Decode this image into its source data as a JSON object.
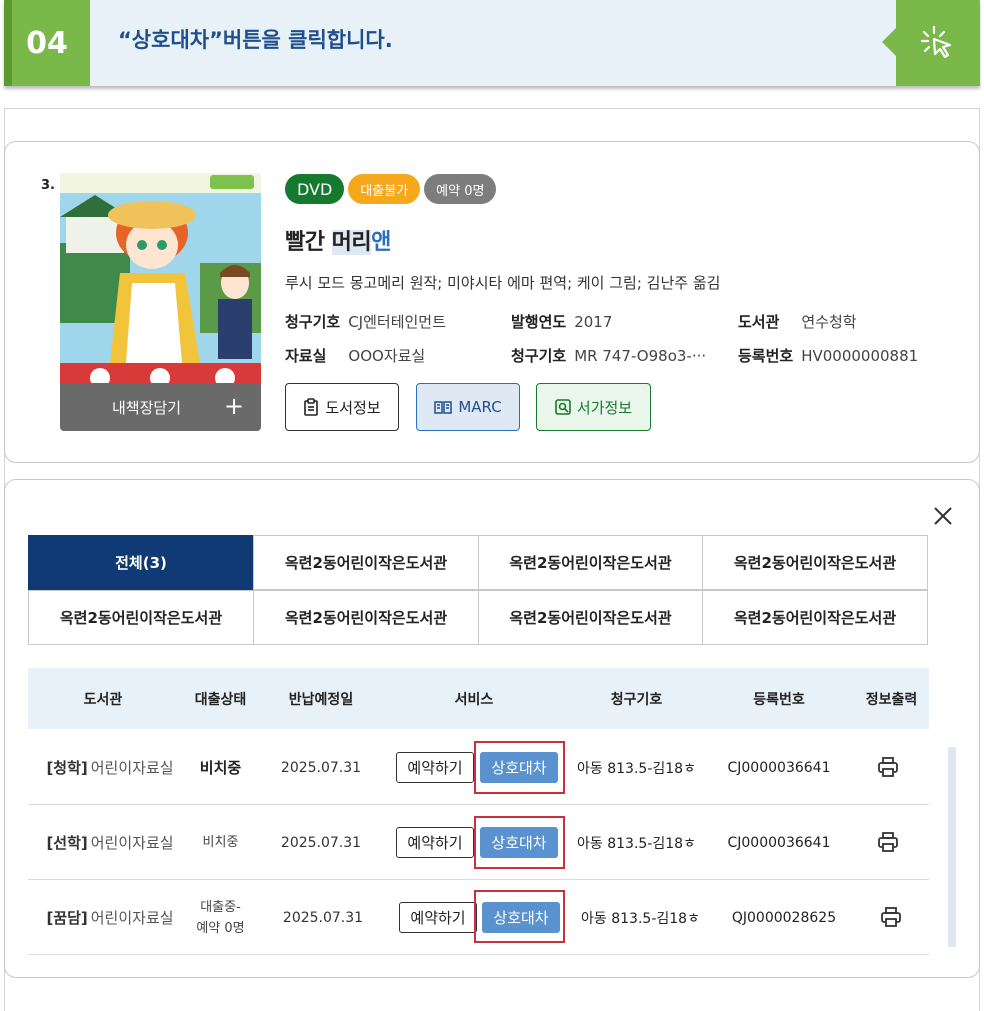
{
  "step": {
    "number": "04",
    "instruction": "“상호대차”버튼을 클릭합니다.",
    "icon": "click-icon",
    "accent": "#7ab84a"
  },
  "book": {
    "index": "3.",
    "cover_action": "내책장담기",
    "cover_action_icon": "plus-icon",
    "badges": [
      "DVD",
      "대출불가",
      "예약 0명"
    ],
    "badge_colors": [
      "#167a2e",
      "#f5a81c",
      "#7d7d7d"
    ],
    "title_part1": "빨간 ",
    "title_part2": "머리",
    "title_part3": "앤",
    "author": "루시 모드 몽고메리 원작; 미야시타 에마 편역; 케이 그림; 김난주 옮김",
    "meta": {
      "call_label": "청구기호",
      "call_value": "CJ엔터테인먼트",
      "year_label": "발행연도",
      "year_value": "2017",
      "library_label": "도서관",
      "library_value": "연수청학",
      "room_label": "자료실",
      "room_value": "OOO자료실",
      "call2_label": "청구기호",
      "call2_value": "MR 747-O98o3-···",
      "reg_label": "등록번호",
      "reg_value": "HV0000000881"
    },
    "buttons": {
      "info": "도서정보",
      "marc": "MARC",
      "shelf": "서가정보"
    }
  },
  "holdings": {
    "tabs": [
      "전체(3)",
      "옥련2동어린이작은도서관",
      "옥련2동어린이작은도서관",
      "옥련2동어린이작은도서관",
      "옥련2동어린이작은도서관",
      "옥련2동어린이작은도서관",
      "옥련2동어린이작은도서관",
      "옥련2동어린이작은도서관"
    ],
    "columns": [
      "도서관",
      "대출상태",
      "반납예정일",
      "서비스",
      "청구기호",
      "등록번호",
      "정보출력"
    ],
    "rows": [
      {
        "branch": "[청학]",
        "room": "어린이자료실",
        "status": "비치중",
        "status2": "",
        "due": "2025.07.31",
        "reserve": "예약하기",
        "loan": "상호대차",
        "call": "아동 813.5-김18ㅎ",
        "reg": "CJ0000036641"
      },
      {
        "branch": "[선학]",
        "room": "어린이자료실",
        "status": "비치중",
        "status2": "",
        "due": "2025.07.31",
        "reserve": "예약하기",
        "loan": "상호대차",
        "call": "아동 813.5-김18ㅎ",
        "reg": "CJ0000036641"
      },
      {
        "branch": "[꿈담]",
        "room": "어린이자료실",
        "status": "대출중-",
        "status2": "예약 0명",
        "due": "2025.07.31",
        "reserve": "예약하기",
        "loan": "상호대차",
        "call": "아동 813.5-김18ㅎ",
        "reg": "QJ0000028625"
      }
    ],
    "highlight_color": "#c8323c",
    "loan_button_color": "#5a92d0"
  }
}
